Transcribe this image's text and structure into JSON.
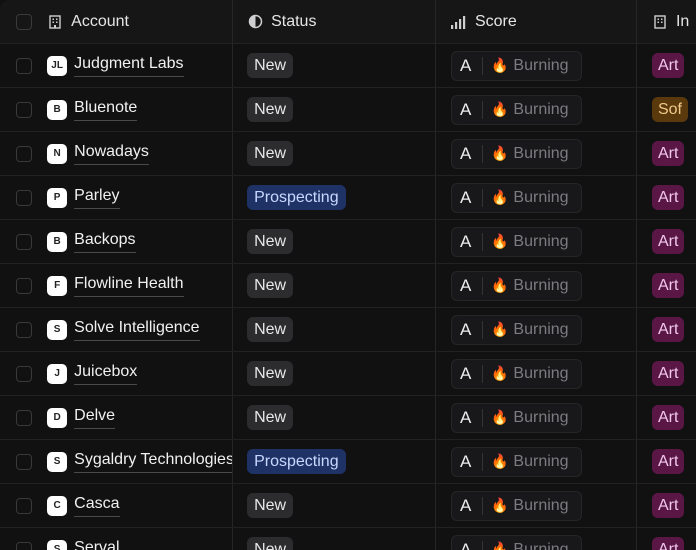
{
  "header": {
    "account": "Account",
    "status": "Status",
    "score": "Score",
    "industry": "In"
  },
  "rows": [
    {
      "name": "Judgment Labs",
      "logo": "JL",
      "status": "New",
      "grade": "A",
      "score": "Burning",
      "industry": "Art",
      "industry_color": "#5a1746"
    },
    {
      "name": "Bluenote",
      "logo": "B",
      "status": "New",
      "grade": "A",
      "score": "Burning",
      "industry": "Sof",
      "industry_color": "#5a3a0c"
    },
    {
      "name": "Nowadays",
      "logo": "N",
      "status": "New",
      "grade": "A",
      "score": "Burning",
      "industry": "Art",
      "industry_color": "#5a1746"
    },
    {
      "name": "Parley",
      "logo": "P",
      "status": "Prospecting",
      "grade": "A",
      "score": "Burning",
      "industry": "Art",
      "industry_color": "#5a1746"
    },
    {
      "name": "Backops",
      "logo": "B",
      "status": "New",
      "grade": "A",
      "score": "Burning",
      "industry": "Art",
      "industry_color": "#5a1746"
    },
    {
      "name": "Flowline Health",
      "logo": "F",
      "status": "New",
      "grade": "A",
      "score": "Burning",
      "industry": "Art",
      "industry_color": "#5a1746"
    },
    {
      "name": "Solve Intelligence",
      "logo": "S",
      "status": "New",
      "grade": "A",
      "score": "Burning",
      "industry": "Art",
      "industry_color": "#5a1746"
    },
    {
      "name": "Juicebox",
      "logo": "J",
      "status": "New",
      "grade": "A",
      "score": "Burning",
      "industry": "Art",
      "industry_color": "#5a1746"
    },
    {
      "name": "Delve",
      "logo": "D",
      "status": "New",
      "grade": "A",
      "score": "Burning",
      "industry": "Art",
      "industry_color": "#5a1746"
    },
    {
      "name": "Sygaldry Technologies",
      "logo": "S",
      "status": "Prospecting",
      "grade": "A",
      "score": "Burning",
      "industry": "Art",
      "industry_color": "#5a1746"
    },
    {
      "name": "Casca",
      "logo": "C",
      "status": "New",
      "grade": "A",
      "score": "Burning",
      "industry": "Art",
      "industry_color": "#5a1746"
    },
    {
      "name": "Serval",
      "logo": "S",
      "status": "New",
      "grade": "A",
      "score": "Burning",
      "industry": "Art",
      "industry_color": "#5a1746"
    }
  ]
}
